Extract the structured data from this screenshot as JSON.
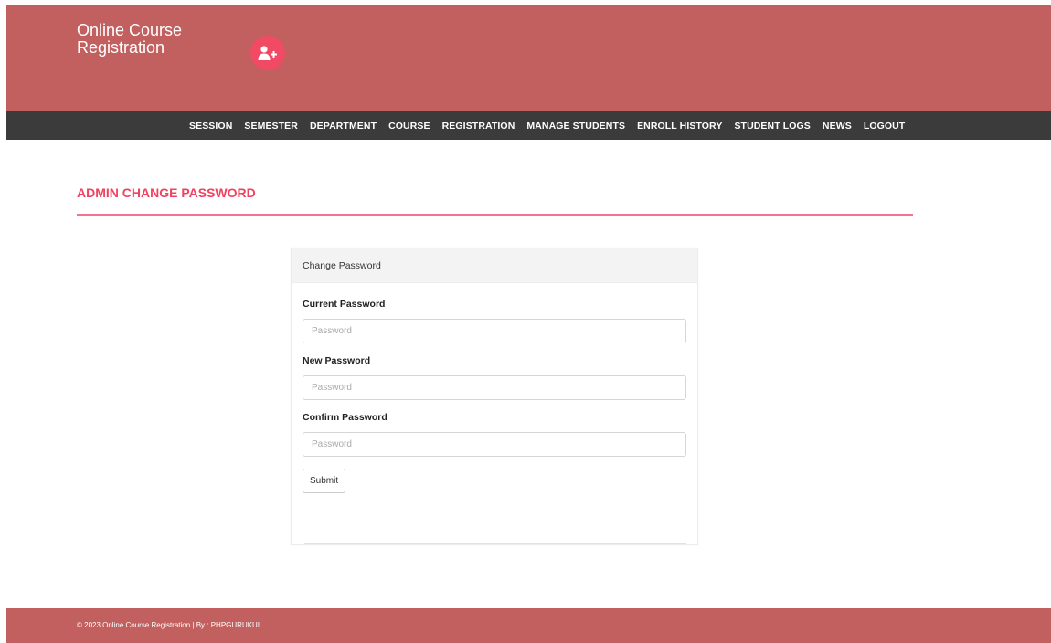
{
  "header": {
    "brand_title": "Online Course Registration",
    "brand_icon": "user-plus-icon",
    "brand_color": "#c1605f",
    "icon_bg_color": "#f04a65"
  },
  "nav": {
    "items": [
      {
        "label": "SESSION"
      },
      {
        "label": "SEMESTER"
      },
      {
        "label": "DEPARTMENT"
      },
      {
        "label": "COURSE"
      },
      {
        "label": "REGISTRATION"
      },
      {
        "label": "MANAGE STUDENTS"
      },
      {
        "label": "ENROLL HISTORY"
      },
      {
        "label": "STUDENT LOGS"
      },
      {
        "label": "NEWS"
      },
      {
        "label": "LOGOUT"
      }
    ]
  },
  "page": {
    "title": "ADMIN CHANGE PASSWORD",
    "accent_color": "#f0415f"
  },
  "form": {
    "heading": "Change Password",
    "current_label": "Current Password",
    "current_placeholder": "Password",
    "current_value": "",
    "new_label": "New Password",
    "new_placeholder": "Password",
    "new_value": "",
    "confirm_label": "Confirm Password",
    "confirm_placeholder": "Password",
    "confirm_value": "",
    "submit_label": "Submit"
  },
  "footer": {
    "text": "© 2023 Online Course Registration | By : PHPGURUKUL"
  }
}
